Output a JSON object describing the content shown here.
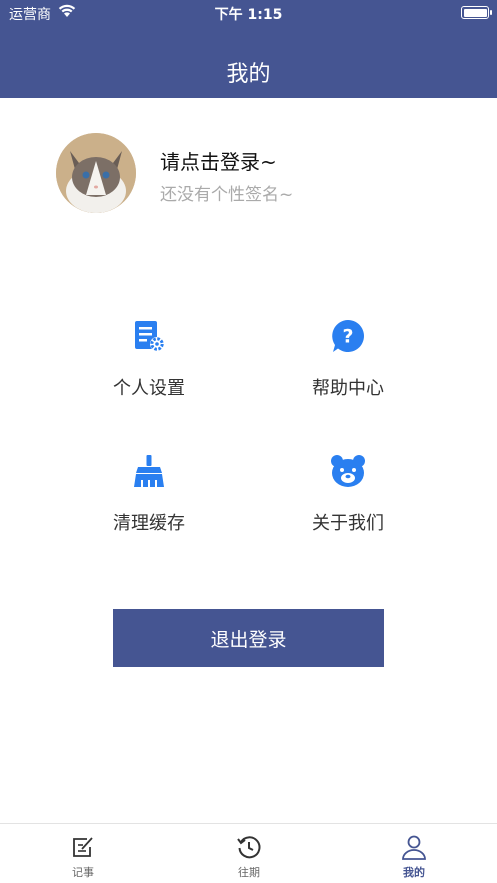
{
  "status_bar": {
    "carrier": "运营商",
    "time": "下午 1:15"
  },
  "header": {
    "title": "我的"
  },
  "profile": {
    "name": "请点击登录~",
    "signature": "还没有个性签名~"
  },
  "menu": {
    "items": [
      {
        "label": "个人设置",
        "icon": "settings-doc-icon"
      },
      {
        "label": "帮助中心",
        "icon": "help-bubble-icon"
      },
      {
        "label": "清理缓存",
        "icon": "broom-icon"
      },
      {
        "label": "关于我们",
        "icon": "bear-icon"
      }
    ]
  },
  "logout_label": "退出登录",
  "tabs": [
    {
      "label": "记事",
      "icon": "notepad-icon"
    },
    {
      "label": "往期",
      "icon": "history-icon"
    },
    {
      "label": "我的",
      "icon": "user-icon",
      "active": true
    }
  ],
  "colors": {
    "primary": "#455592",
    "icon_blue": "#2a7ff0"
  }
}
